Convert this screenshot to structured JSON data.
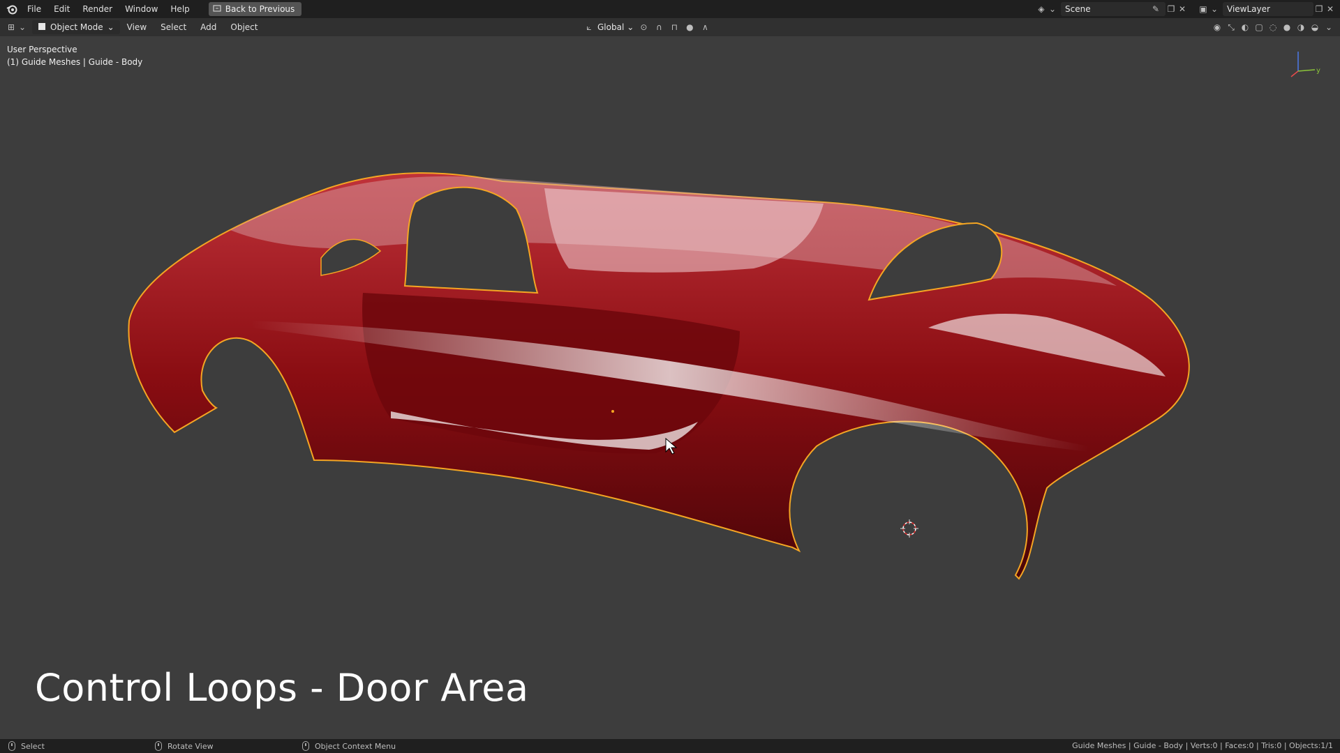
{
  "topbar": {
    "menus": [
      "File",
      "Edit",
      "Render",
      "Window",
      "Help"
    ],
    "back_label": "Back to Previous",
    "scene_label": "Scene",
    "viewlayer_label": "ViewLayer"
  },
  "viewport_header": {
    "mode_label": "Object Mode",
    "menus": [
      "View",
      "Select",
      "Add",
      "Object"
    ],
    "transform_label": "Global"
  },
  "viewport": {
    "perspective_label": "User Perspective",
    "object_label": "(1) Guide Meshes | Guide - Body",
    "caption": "Control Loops - Door Area",
    "gizmo_axis_label": "y"
  },
  "statusbar": {
    "select_label": "Select",
    "rotate_label": "Rotate View",
    "context_label": "Object Context Menu",
    "stats": "Guide Meshes | Guide - Body | Verts:0 | Faces:0 | Tris:0 | Objects:1/1"
  },
  "colors": {
    "car_red": "#8a0d12",
    "outline": "#f5a623",
    "viewport_bg": "#3d3d3d"
  }
}
